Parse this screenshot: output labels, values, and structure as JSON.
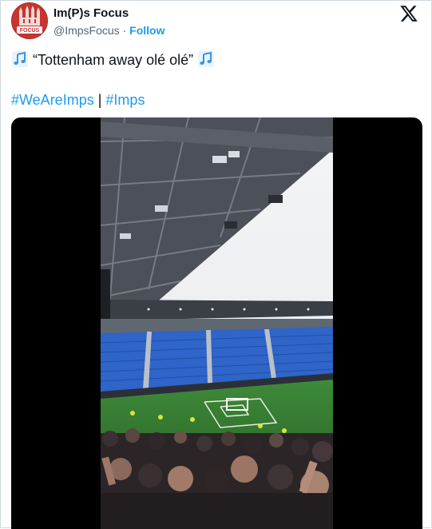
{
  "tweet": {
    "author_name": "Im(P)s Focus",
    "handle": "@ImpsFocus",
    "separator": "·",
    "follow_label": "Follow",
    "text": "“Tottenham away olé olé”",
    "hashtags": [
      "#WeAreImps",
      "#Imps"
    ],
    "hashtag_separator": "|"
  },
  "avatar": {
    "badge_text": "FOCUS"
  },
  "icons": {
    "platform": "x-logo-icon",
    "music": "musical-notes-icon"
  },
  "colors": {
    "link": "#1d9bf0",
    "text": "#0f1419",
    "secondary": "#536471",
    "avatar": "#c8342f"
  }
}
